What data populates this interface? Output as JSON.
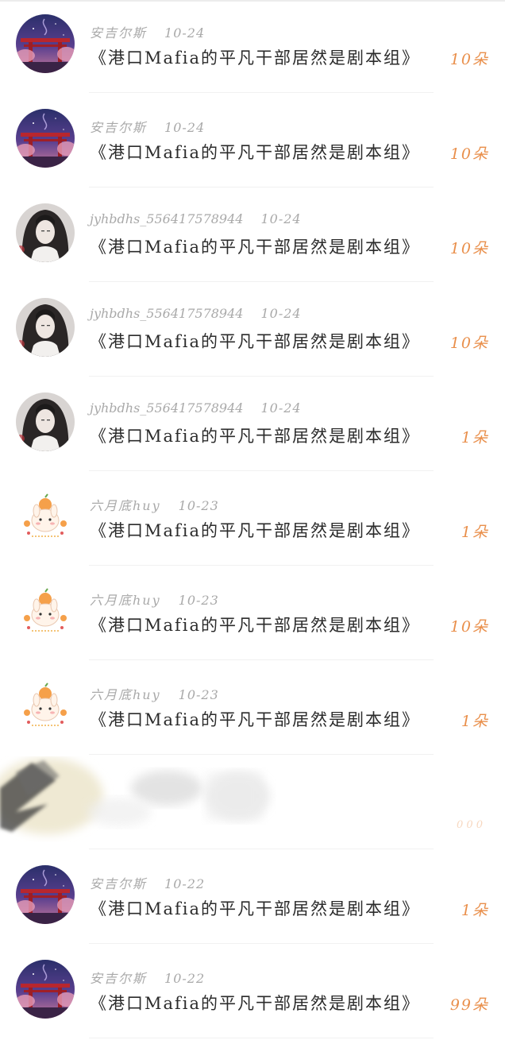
{
  "items": [
    {
      "user": "安吉尔斯",
      "date": "10-24",
      "title": "《港口Mafia的平凡干部居然是剧本组》",
      "count": "10朵",
      "avatar": "torii-night-avatar"
    },
    {
      "user": "安吉尔斯",
      "date": "10-24",
      "title": "《港口Mafia的平凡干部居然是剧本组》",
      "count": "10朵",
      "avatar": "torii-night-avatar"
    },
    {
      "user": "jyhbdhs_556417578944",
      "date": "10-24",
      "title": "《港口Mafia的平凡干部居然是剧本组》",
      "count": "10朵",
      "avatar": "dark-hair-character-avatar"
    },
    {
      "user": "jyhbdhs_556417578944",
      "date": "10-24",
      "title": "《港口Mafia的平凡干部居然是剧本组》",
      "count": "10朵",
      "avatar": "dark-hair-character-avatar"
    },
    {
      "user": "jyhbdhs_556417578944",
      "date": "10-24",
      "title": "《港口Mafia的平凡干部居然是剧本组》",
      "count": "1朵",
      "avatar": "dark-hair-character-avatar"
    },
    {
      "user": "六月底huy",
      "date": "10-23",
      "title": "《港口Mafia的平凡干部居然是剧本组》",
      "count": "1朵",
      "avatar": "bunny-orange-avatar"
    },
    {
      "user": "六月底huy",
      "date": "10-23",
      "title": "《港口Mafia的平凡干部居然是剧本组》",
      "count": "10朵",
      "avatar": "bunny-orange-avatar"
    },
    {
      "user": "六月底huy",
      "date": "10-23",
      "title": "《港口Mafia的平凡干部居然是剧本组》",
      "count": "1朵",
      "avatar": "bunny-orange-avatar"
    },
    {
      "user": "",
      "date": "",
      "title": "",
      "count": "",
      "avatar": "redacted",
      "redacted": true
    },
    {
      "user": "安吉尔斯",
      "date": "10-22",
      "title": "《港口Mafia的平凡干部居然是剧本组》",
      "count": "1朵",
      "avatar": "torii-night-avatar"
    },
    {
      "user": "安吉尔斯",
      "date": "10-22",
      "title": "《港口Mafia的平凡干部居然是剧本组》",
      "count": "99朵",
      "avatar": "torii-night-avatar"
    }
  ],
  "colors": {
    "count": "#e98f4b",
    "meta": "#a9a9a9",
    "title": "#2b2b2b"
  }
}
